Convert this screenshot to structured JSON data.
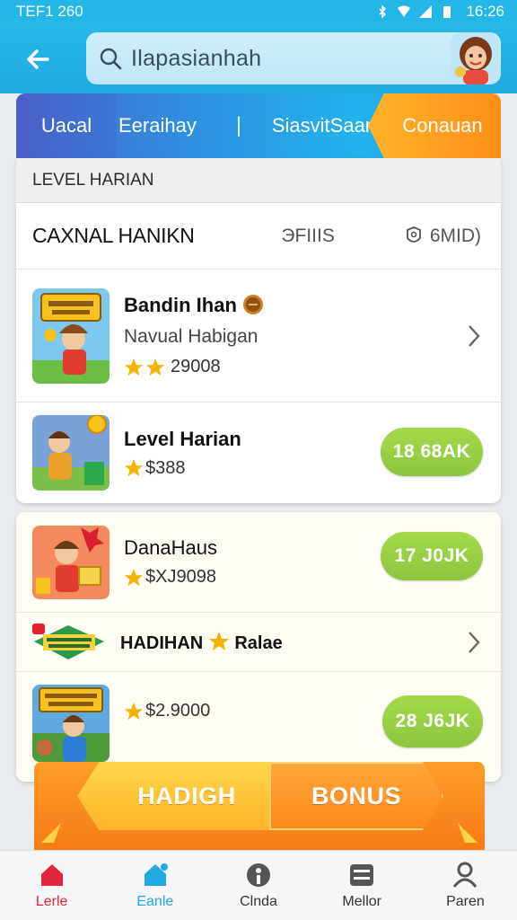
{
  "status_bar": {
    "left": "TEF1 260",
    "time": "16:26"
  },
  "search": {
    "placeholder": "Ilapasianhah"
  },
  "tabs": [
    {
      "label": "Uacal"
    },
    {
      "label": "Eeraihay"
    },
    {
      "label": "SiasvitSaam"
    },
    {
      "label": "Conauan"
    }
  ],
  "level_panel": {
    "header": "LEVEL HARIAN",
    "filter_title": "CAXNAL HANIKN",
    "filter_mid": "ЭFIIIS",
    "filter_end": "6MID)"
  },
  "items": [
    {
      "name": "Bandin Ihan",
      "subtitle": "Navual Habigan",
      "rating": "29008",
      "stars": 2,
      "action": "chevron"
    },
    {
      "name": "Level Harian",
      "rating": "$388",
      "stars": 1,
      "action_label": "18 68AK"
    },
    {
      "name": "DanaHaus",
      "rating": "$XJ9098",
      "stars": 1,
      "action_label": "17 J0JK"
    },
    {
      "name": "HADIHAN",
      "name_suffix": "Ralae",
      "action": "chevron"
    },
    {
      "rating": "$2.9000",
      "stars": 1,
      "action_label": "28 J6JK"
    }
  ],
  "promo": {
    "left_label": "HADIGH",
    "right_label": "BONUS"
  },
  "bottom_nav": [
    {
      "label": "Lerle",
      "icon": "home-icon",
      "color": "#e0263c"
    },
    {
      "label": "Eanle",
      "icon": "home-icon",
      "color": "#1fa9df"
    },
    {
      "label": "Clnda",
      "icon": "info-icon",
      "color": "#333333"
    },
    {
      "label": "Mellor",
      "icon": "list-icon",
      "color": "#333333"
    },
    {
      "label": "Paren",
      "icon": "user-icon",
      "color": "#333333"
    }
  ],
  "colors": {
    "primary": "#23b6e6",
    "accent": "#ff9d2a",
    "pill": "#8cc63f",
    "active_nav": "#e0263c"
  }
}
